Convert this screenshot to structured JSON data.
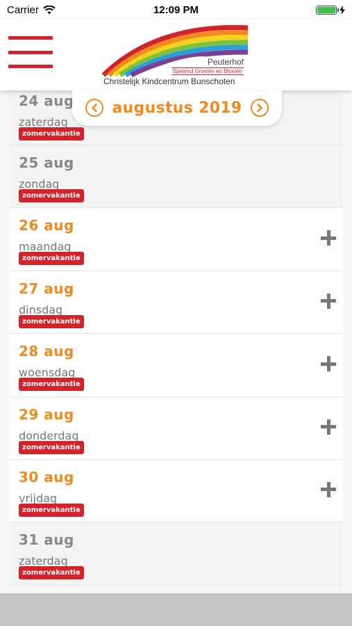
{
  "status_bar": {
    "carrier": "Carrier",
    "time": "12:09 PM"
  },
  "header": {
    "logo": {
      "name": "Peuterhof",
      "tagline": "Spelend Groeien en Bloeien",
      "school": "Christelijk Kindcentrum Bunschoten"
    }
  },
  "month_nav": {
    "label": "augustus 2019"
  },
  "days": [
    {
      "date": "24 aug",
      "weekday": "zaterdag",
      "badge": "zomervakantie"
    },
    {
      "date": "25 aug",
      "weekday": "zondag",
      "badge": "zomervakantie"
    },
    {
      "date": "26 aug",
      "weekday": "maandag",
      "badge": "zomervakantie"
    },
    {
      "date": "27 aug",
      "weekday": "dinsdag",
      "badge": "zomervakantie"
    },
    {
      "date": "28 aug",
      "weekday": "woensdag",
      "badge": "zomervakantie"
    },
    {
      "date": "29 aug",
      "weekday": "donderdag",
      "badge": "zomervakantie"
    },
    {
      "date": "30 aug",
      "weekday": "vrijdag",
      "badge": "zomervakantie"
    },
    {
      "date": "31 aug",
      "weekday": "zaterdag",
      "badge": "zomervakantie"
    }
  ],
  "colors": {
    "accent": "#f0891e",
    "brand_red": "#d2232a",
    "weekend_text": "#888888"
  },
  "icons": {
    "menu": "hamburger-icon",
    "prev": "chevron-left-circle-icon",
    "next": "chevron-right-circle-icon",
    "add": "plus-icon",
    "wifi": "wifi-icon",
    "battery": "battery-icon"
  }
}
